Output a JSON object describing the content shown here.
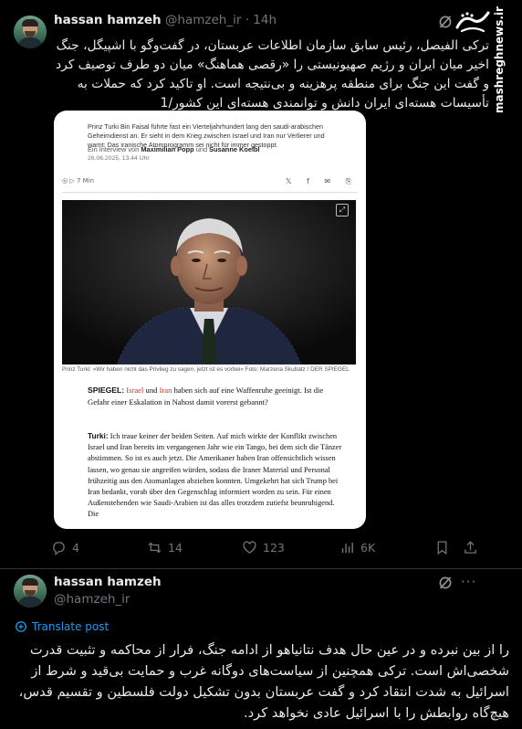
{
  "tweet1": {
    "author_name": "hassan hamzeh",
    "author_handle": "@hamzeh_ir",
    "separator": "·",
    "time": "14h",
    "text": "ترکی الفیصل، رئیس سابق سازمان اطلاعات عربستان، در گفت‌وگو با اشپیگل، جنگ اخیر میان ایران و رژیم صهیونیستی را «رقصی هماهنگ» میان دو طرف توصیف کرد و گفت این جنگ برای منطقه پرهزینه و بی‌نتیجه است. او تاکید کرد که حملات به تأسیسات هسته‌ای ایران دانش و توانمندی هسته‌ای این کشور/1",
    "media": {
      "intro": "Prinz Turki Bin Faisal führte fast ein Vierteljahrhundert lang den saudi-arabischen Geheimdienst an. Er sieht in dem Krieg zwischen Israel und Iran nur Verlierer und warnt: Das iranische Atomprogramm sei nicht für immer gestoppt.",
      "interview_prefix": "Ein Interview von",
      "author_a": "Maximilian Popp",
      "and": "und",
      "author_b": "Susanne Koelbl",
      "date": "26.06.2025, 13.44 Uhr",
      "listen_label": "7 Min",
      "share_icons": "𝕏 f ✉ ⎘",
      "caption": "Prinz Turki: »Wir haben nicht das Privileg zu sagen, jetzt ist es vorbei«   Foto: Marzena Skubatz / DER SPIEGEL",
      "question_label": "SPIEGEL:",
      "q_israel": "Israel",
      "q_und": "und",
      "q_iran": "Iran",
      "question_rest": "haben sich auf eine Waffenruhe geeinigt. Ist die Gefahr einer Eskalation in Nahost damit vorerst gebannt?",
      "answer_label": "Turki:",
      "answer_text": "Ich traue keiner der beiden Seiten. Auf mich wirkte der Konflikt zwischen Israel und Iran bereits im vergangenen Jahr wie ein Tango, bei dem sich die Tänzer abstimmen. So ist es auch jetzt. Die Amerikaner haben Iran offensichtlich wissen lassen, wo genau sie angreifen würden, sodass die Iraner Material und Personal frühzeitig aus den Atomanlagen abziehen konnten. Umgekehrt hat sich Trump bei Iran bedankt, vorab über den Gegenschlag informiert worden zu sein. Für einen Außenstehenden wie Saudi-Arabien ist das alles trotzdem zutiefst beunruhigend. Die"
    },
    "actions": {
      "replies": "4",
      "reposts": "14",
      "likes": "123",
      "views": "6K"
    }
  },
  "watermark": {
    "logo_text": "مشرق",
    "url": "mashreghnews.ir"
  },
  "tweet2": {
    "author_name": "hassan hamzeh",
    "author_handle": "@hamzeh_ir",
    "more": "···",
    "translate_label": "Translate post",
    "text": "را از بین نبرده و در عین حال هدف نتانیاهو از ادامه جنگ، فرار از محاکمه و تثبیت قدرت شخصی‌اش است. ترکی همچنین از سیاست‌های دوگانه غرب و حمایت بی‌قید و شرط از اسرائیل به شدت انتقاد کرد و گفت عربستان بدون تشکیل دولت فلسطین و تقسیم قدس، هیچ‌گاه روابطش را با اسرائیل عادی نخواهد کرد."
  },
  "colors": {
    "background": "#000000",
    "text_primary": "#e7e9ea",
    "text_secondary": "#71767b",
    "accent": "#1d9bf0",
    "spiegel_red": "#c0392b"
  },
  "icons": [
    "grok-icon",
    "reply-icon",
    "repost-icon",
    "like-icon",
    "views-icon",
    "bookmark-icon",
    "share-icon",
    "translate-icon",
    "more-icon",
    "expand-icon"
  ]
}
